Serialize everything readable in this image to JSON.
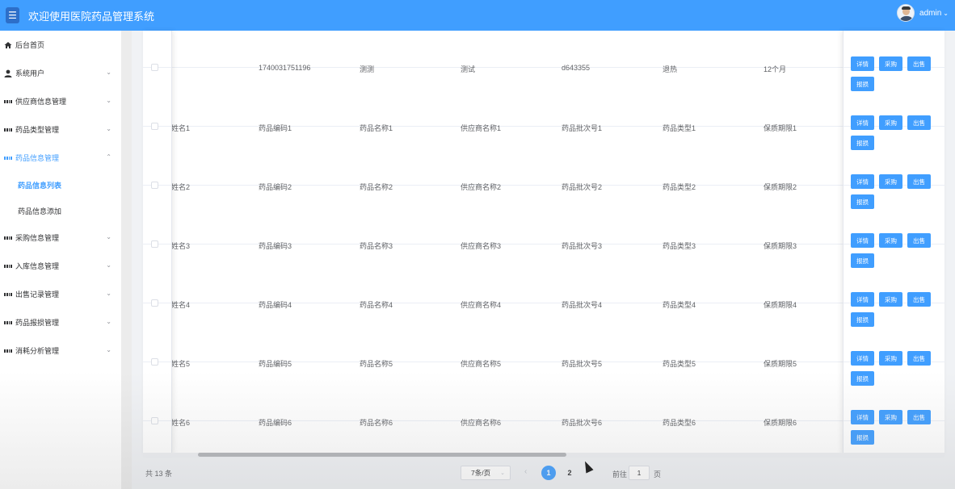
{
  "header": {
    "title": "欢迎使用医院药品管理系统",
    "user": "admin",
    "menu_icon": "hamburger-icon"
  },
  "sidebar": {
    "items": [
      {
        "label": "后台首页",
        "icon": "home-icon",
        "expandable": false
      },
      {
        "label": "系统用户",
        "icon": "user-icon",
        "expandable": true
      },
      {
        "label": "供应商信息管理",
        "icon": "grid-icon",
        "expandable": true
      },
      {
        "label": "药品类型管理",
        "icon": "grid-icon",
        "expandable": true
      },
      {
        "label": "药品信息管理",
        "icon": "grid-icon",
        "expandable": true,
        "expanded": true
      },
      {
        "label": "采购信息管理",
        "icon": "grid-icon",
        "expandable": true
      },
      {
        "label": "入库信息管理",
        "icon": "grid-icon",
        "expandable": true
      },
      {
        "label": "出售记录管理",
        "icon": "grid-icon",
        "expandable": true
      },
      {
        "label": "药品报损管理",
        "icon": "grid-icon",
        "expandable": true
      },
      {
        "label": "消耗分析管理",
        "icon": "grid-icon",
        "expandable": true
      }
    ],
    "sub_items": [
      "药品信息列表",
      "药品信息添加"
    ],
    "accent": "#409eff"
  },
  "table": {
    "rows": [
      [
        "",
        "1740031751196",
        "测测",
        "测试",
        "d643355",
        "退热",
        "12个月"
      ],
      [
        "姓名1",
        "药品编码1",
        "药品名称1",
        "供应商名称1",
        "药品批次号1",
        "药品类型1",
        "保质期限1"
      ],
      [
        "姓名2",
        "药品编码2",
        "药品名称2",
        "供应商名称2",
        "药品批次号2",
        "药品类型2",
        "保质期限2"
      ],
      [
        "姓名3",
        "药品编码3",
        "药品名称3",
        "供应商名称3",
        "药品批次号3",
        "药品类型3",
        "保质期限3"
      ],
      [
        "姓名4",
        "药品编码4",
        "药品名称4",
        "供应商名称4",
        "药品批次号4",
        "药品类型4",
        "保质期限4"
      ],
      [
        "姓名5",
        "药品编码5",
        "药品名称5",
        "供应商名称5",
        "药品批次号5",
        "药品类型5",
        "保质期限5"
      ],
      [
        "姓名6",
        "药品编码6",
        "药品名称6",
        "供应商名称6",
        "药品批次号6",
        "药品类型6",
        "保质期限6"
      ]
    ],
    "actions": {
      "detail": "详情",
      "purchase": "采购",
      "sell": "出售",
      "damage": "报损"
    }
  },
  "pagination": {
    "total": "共 13 条",
    "page_size": "7条/页",
    "current_page": "1",
    "other_page": "2",
    "goto_label": "前往",
    "goto_value": "1",
    "page_label": "页"
  }
}
